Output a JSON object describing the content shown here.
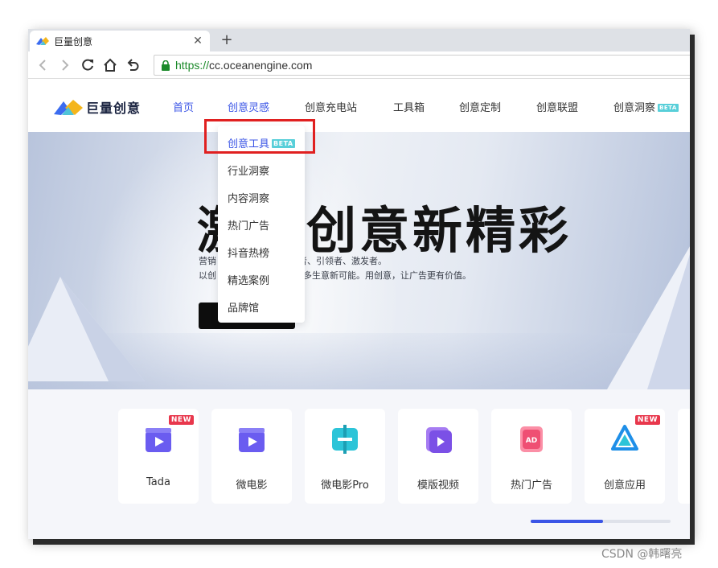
{
  "browser": {
    "tab_title": "巨量创意",
    "url_scheme": "https://",
    "url_host": "cc.oceanengine.com"
  },
  "header": {
    "logo_text": "巨量创意",
    "nav": [
      {
        "label": "首页"
      },
      {
        "label": "创意灵感"
      },
      {
        "label": "创意充电站"
      },
      {
        "label": "工具箱"
      },
      {
        "label": "创意定制"
      },
      {
        "label": "创意联盟"
      },
      {
        "label": "创意洞察",
        "badge": "BETA"
      }
    ]
  },
  "dropdown": {
    "items": [
      {
        "label": "创意工具",
        "badge": "BETA"
      },
      {
        "label": "行业洞察"
      },
      {
        "label": "内容洞察"
      },
      {
        "label": "热门广告"
      },
      {
        "label": "抖音热榜"
      },
      {
        "label": "精选案例"
      },
      {
        "label": "品牌馆"
      }
    ]
  },
  "hero": {
    "title_left": "激",
    "title_right": "创意新精彩",
    "sub1_left": "营销",
    "sub1_right": "者、引领者、激发者。",
    "sub2_left": "以创",
    "sub2_right": "多生意新可能。用创意，让广告更有价值。"
  },
  "tools": {
    "cards": [
      {
        "label": "Tada",
        "badge": "NEW",
        "icon": "clapper-play-icon"
      },
      {
        "label": "微电影",
        "icon": "clapper-play-icon"
      },
      {
        "label": "微电影Pro",
        "icon": "split-film-icon"
      },
      {
        "label": "模版视频",
        "icon": "template-video-icon"
      },
      {
        "label": "热门广告",
        "icon": "ad-icon"
      },
      {
        "label": "创意应用",
        "badge": "NEW",
        "icon": "creative-app-icon"
      }
    ],
    "scroll_progress": 0.52
  },
  "watermark": "CSDN @韩曙亮",
  "colors": {
    "accent": "#3b55e6",
    "highlight": "#e02020",
    "new_badge": "#e8374c",
    "beta_badge": "#58cfd9"
  }
}
